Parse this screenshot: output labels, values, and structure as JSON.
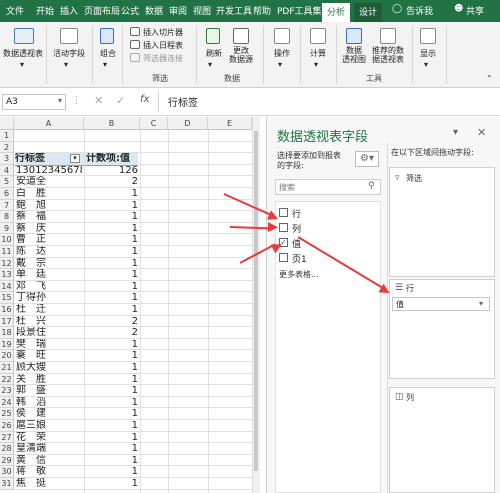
{
  "tabs": [
    "文件",
    "开始",
    "插入",
    "页面布局",
    "公式",
    "数据",
    "审阅",
    "视图",
    "开发工具",
    "帮助",
    "PDF工具集",
    "分析",
    "设计"
  ],
  "tell_me": "告诉我",
  "share": "共享",
  "ribbon": {
    "pivot_table": "数据透视表",
    "active_field": "活动字段",
    "group": "组合",
    "insert_slicer": "插入切片器",
    "insert_timeline": "插入日程表",
    "filter_connections": "筛选器连接",
    "filter_group": "筛选",
    "refresh": "刷新",
    "change_source": "更改\n数据源",
    "data_group": "数据",
    "actions": "操作",
    "calculations": "计算",
    "pivot_chart": "数据\n透视图",
    "recommended": "推荐的数\n据透视表",
    "tools_group": "工具",
    "show": "显示"
  },
  "formula_bar": {
    "name_box": "A3",
    "fx": "fx",
    "content": "行标签"
  },
  "grid": {
    "columns": [
      "A",
      "B",
      "C",
      "D",
      "E"
    ],
    "rows": [
      {
        "n": "1",
        "a": "",
        "b": ""
      },
      {
        "n": "2",
        "a": "",
        "b": ""
      },
      {
        "n": "3",
        "a": "行标签",
        "b": "计数项:值"
      },
      {
        "n": "4",
        "a": "13012345678",
        "b": "126"
      },
      {
        "n": "5",
        "a": "安道全",
        "b": "2"
      },
      {
        "n": "6",
        "a": "白　胜",
        "b": "1"
      },
      {
        "n": "7",
        "a": "鲍　旭",
        "b": "1"
      },
      {
        "n": "8",
        "a": "蔡　福",
        "b": "1"
      },
      {
        "n": "9",
        "a": "蔡　庆",
        "b": "1"
      },
      {
        "n": "10",
        "a": "曹　正",
        "b": "1"
      },
      {
        "n": "11",
        "a": "陈　达",
        "b": "1"
      },
      {
        "n": "12",
        "a": "戴　宗",
        "b": "1"
      },
      {
        "n": "13",
        "a": "单　廷",
        "b": "1"
      },
      {
        "n": "14",
        "a": "邓　飞",
        "b": "1"
      },
      {
        "n": "15",
        "a": "丁得孙",
        "b": "1"
      },
      {
        "n": "16",
        "a": "杜　迁",
        "b": "1"
      },
      {
        "n": "17",
        "a": "杜　兴",
        "b": "2"
      },
      {
        "n": "18",
        "a": "段景住",
        "b": "2"
      },
      {
        "n": "19",
        "a": "樊　瑞",
        "b": "1"
      },
      {
        "n": "20",
        "a": "蓑　旺",
        "b": "1"
      },
      {
        "n": "21",
        "a": "顾大嫂",
        "b": "1"
      },
      {
        "n": "22",
        "a": "关　胜",
        "b": "1"
      },
      {
        "n": "23",
        "a": "郭　盛",
        "b": "1"
      },
      {
        "n": "24",
        "a": "韩　滔",
        "b": "1"
      },
      {
        "n": "25",
        "a": "侯　建",
        "b": "1"
      },
      {
        "n": "26",
        "a": "扈三娘",
        "b": "1"
      },
      {
        "n": "27",
        "a": "花　荣",
        "b": "1"
      },
      {
        "n": "28",
        "a": "皇清端",
        "b": "1"
      },
      {
        "n": "29",
        "a": "黄　信",
        "b": "1"
      },
      {
        "n": "30",
        "a": "蒋　敬",
        "b": "1"
      },
      {
        "n": "31",
        "a": "焦　挺",
        "b": "1"
      }
    ]
  },
  "pane": {
    "title": "数据透视表字段",
    "choose_fields": "选择要添加到报表\n的字段:",
    "search_placeholder": "搜索",
    "fields": [
      {
        "label": "行",
        "checked": false
      },
      {
        "label": "列",
        "checked": false
      },
      {
        "label": "值",
        "checked": true
      },
      {
        "label": "页1",
        "checked": false
      }
    ],
    "more_tables": "更多表格...",
    "drag_hint": "在以下区域间拖动字段:",
    "filters_label": "筛选",
    "rows_label": "行",
    "rows_item": "值",
    "columns_label": "列"
  }
}
